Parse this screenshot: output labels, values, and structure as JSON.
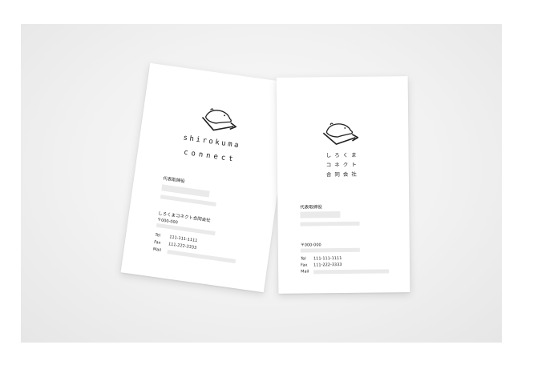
{
  "left_card": {
    "wordmark_line1": "shirokuma",
    "wordmark_line2": "connect",
    "role": "代表取締役",
    "company": "しろくまコネクト合同会社",
    "postal": "〒000-000",
    "tel_label": "Tel",
    "tel_value": "111-111-1111",
    "fax_label": "Fax",
    "fax_value": "111-222-3333",
    "mail_label": "Mail"
  },
  "right_card": {
    "kana_line1": "しろくま",
    "kana_line2": "コネクト",
    "kana_line3": "合同会社",
    "role": "代表取締役",
    "postal": "〒000-000",
    "tel_label": "Tel",
    "tel_value": "111-111-1111",
    "fax_label": "Fax",
    "fax_value": "111-222-3333",
    "mail_label": "Mail"
  },
  "icons": {
    "logo": "polar-bear-arrow-logo-icon"
  }
}
